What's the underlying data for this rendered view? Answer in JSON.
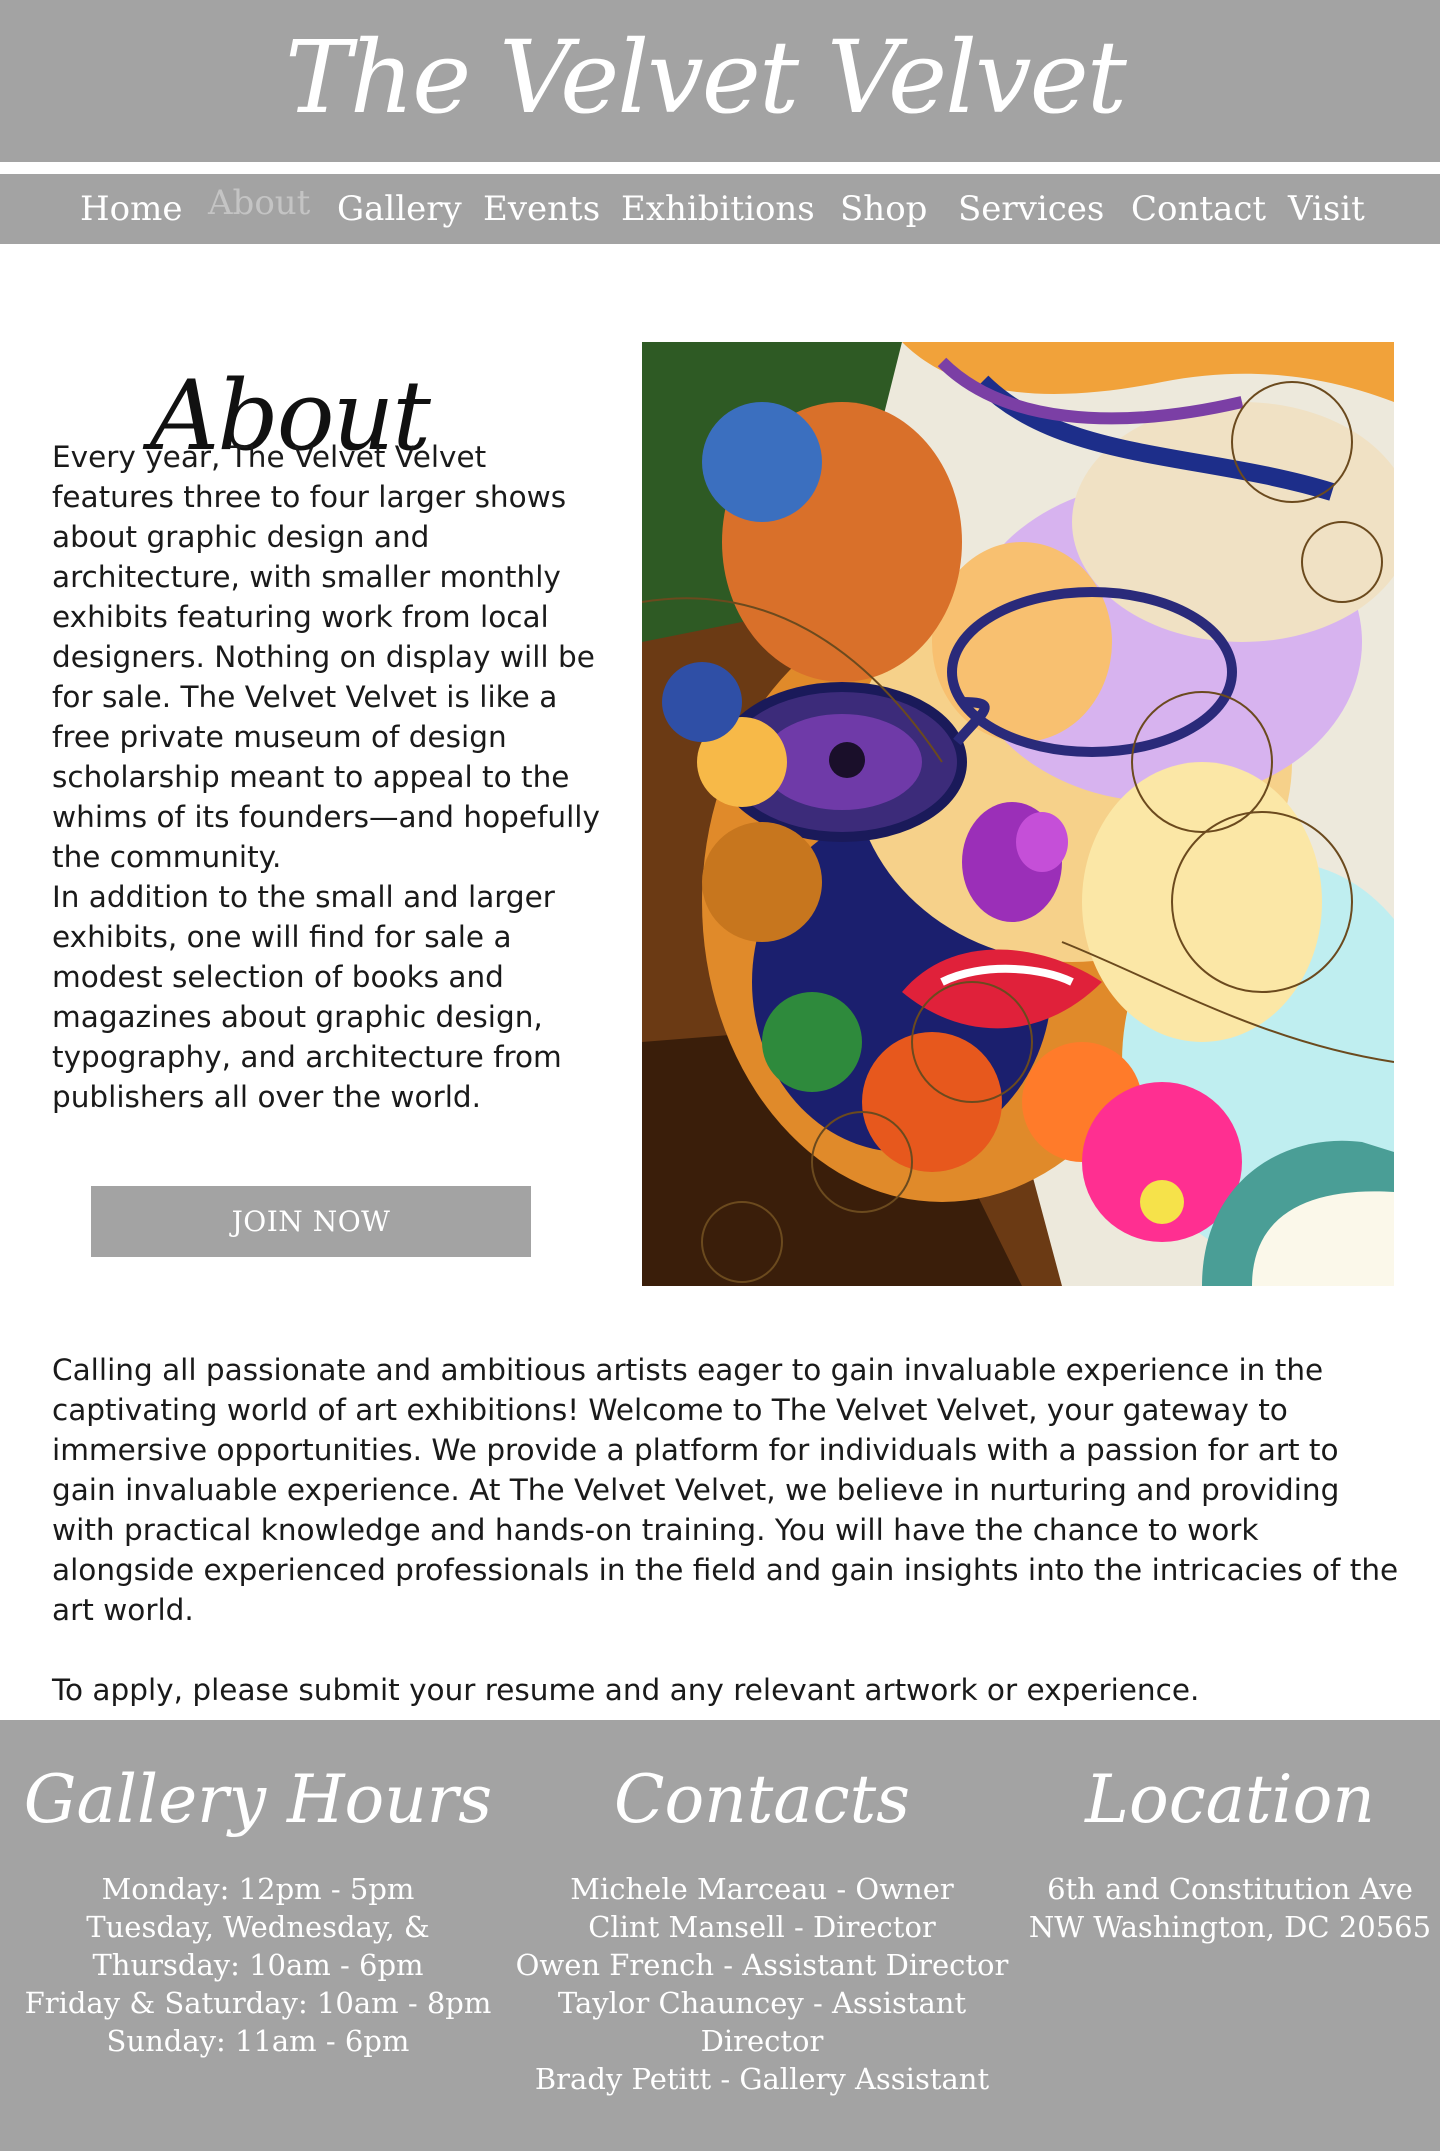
{
  "header": {
    "title": "The Velvet Velvet"
  },
  "nav": {
    "items": [
      {
        "label": "Home"
      },
      {
        "label": "About"
      },
      {
        "label": "Gallery"
      },
      {
        "label": "Events"
      },
      {
        "label": "Exhibitions"
      },
      {
        "label": "Shop"
      },
      {
        "label": "Services"
      },
      {
        "label": "Contact"
      },
      {
        "label": "Visit"
      }
    ],
    "active": "About"
  },
  "about": {
    "heading": "About",
    "paragraphs": [
      "Every year, The Velvet Velvet features three to four larger shows about graphic design and architecture, with smaller monthly exhibits featuring work from local designers. Nothing on display will be for sale. The Velvet Velvet is like a free private museum of design scholarship meant to appeal to the whims of its founders—and hopefully the community.",
      "In addition to the small and larger exhibits, one will find for sale a modest selection of books and magazines about graphic design, typography, and architecture from publishers all over the world."
    ],
    "join_label": "JOIN NOW"
  },
  "call": {
    "paragraphs": [
      "Calling all passionate and ambitious artists eager to gain invaluable experience in the captivating world of art exhibitions! Welcome to The Velvet Velvet, your gateway to immersive opportunities. We provide a platform for individuals with a passion for art to gain invaluable experience. At The Velvet Velvet, we believe in nurturing and providing with practical knowledge and hands-on training.  You will have the chance to work alongside experienced professionals in the field and gain insights into the intricacies of the art world.",
      "To apply, please submit your resume and any relevant artwork or experience."
    ]
  },
  "footer": {
    "hours": {
      "heading": "Gallery Hours",
      "lines": [
        "Monday: 12pm - 5pm",
        "Tuesday, Wednesday, &",
        "Thursday: 10am - 6pm",
        "Friday & Saturday: 10am - 8pm",
        "Sunday: 11am - 6pm"
      ]
    },
    "contacts": {
      "heading": "Contacts",
      "lines": [
        "Michele Marceau - Owner",
        "Clint Mansell - Director",
        "Owen French - Assistant Director",
        "Taylor Chauncey - Assistant",
        "Director",
        "Brady Petitt - Gallery Assistant"
      ]
    },
    "location": {
      "heading": "Location",
      "lines": [
        "6th and Constitution Ave",
        "NW Washington, DC 20565"
      ]
    }
  },
  "colors": {
    "bar_gray": "#a3a3a3",
    "active_nav": "#c4c4c4",
    "text": "#1a1a1a"
  }
}
